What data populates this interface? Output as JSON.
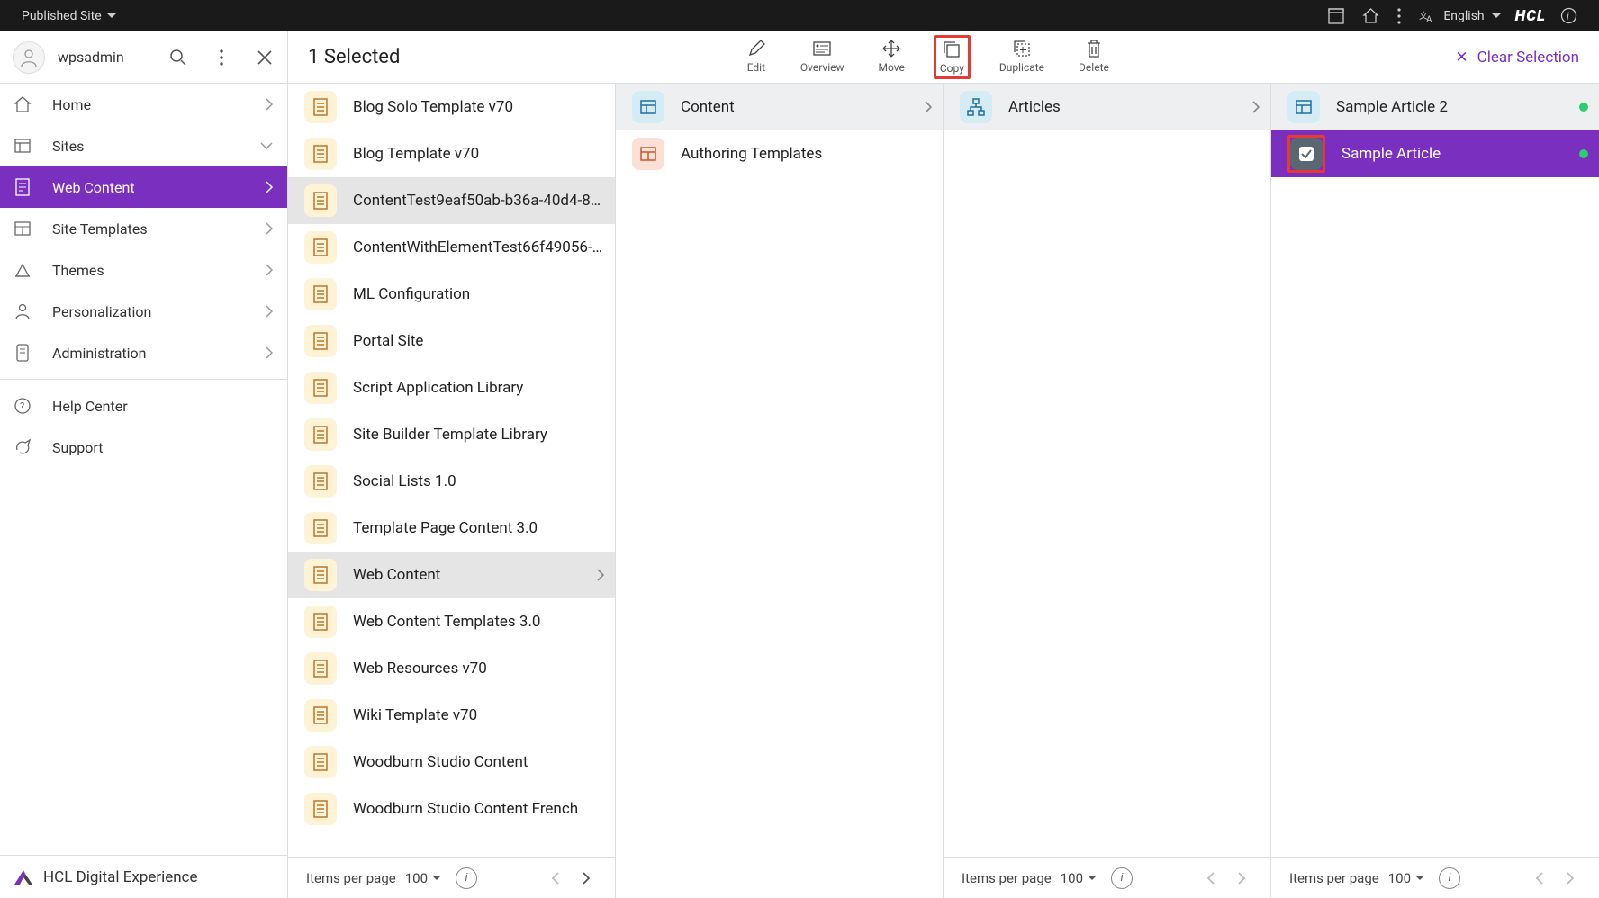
{
  "topbar": {
    "siteLabel": "Published Site",
    "language": "English",
    "logo": "HCL"
  },
  "sidebar": {
    "user": "wpsadmin",
    "items": [
      {
        "icon": "home",
        "label": "Home",
        "chev": "right"
      },
      {
        "icon": "sites",
        "label": "Sites",
        "chev": "down"
      },
      {
        "icon": "doc",
        "label": "Web Content",
        "chev": "right",
        "active": true
      },
      {
        "icon": "sitetpl",
        "label": "Site Templates",
        "chev": "right"
      },
      {
        "icon": "themes",
        "label": "Themes",
        "chev": "right"
      },
      {
        "icon": "person",
        "label": "Personalization",
        "chev": "right"
      },
      {
        "icon": "admin",
        "label": "Administration",
        "chev": "right"
      }
    ],
    "help": {
      "label": "Help Center"
    },
    "support": {
      "label": "Support"
    },
    "footer": "HCL Digital Experience"
  },
  "toolbar": {
    "title": "1 Selected",
    "actions": {
      "edit": "Edit",
      "overview": "Overview",
      "move": "Move",
      "copy": "Copy",
      "duplicate": "Duplicate",
      "delete": "Delete"
    },
    "clear": "Clear Selection"
  },
  "col1": {
    "items": [
      {
        "label": "Blog Solo Template v70"
      },
      {
        "label": "Blog Template v70"
      },
      {
        "label": "ContentTest9eaf50ab-b36a-40d4-8…",
        "hl": true
      },
      {
        "label": "ContentWithElementTest66f49056-…"
      },
      {
        "label": "ML Configuration"
      },
      {
        "label": "Portal Site"
      },
      {
        "label": "Script Application Library"
      },
      {
        "label": "Site Builder Template Library"
      },
      {
        "label": "Social Lists 1.0"
      },
      {
        "label": "Template Page Content 3.0"
      },
      {
        "label": "Web Content",
        "hl": true,
        "chev": true
      },
      {
        "label": "Web Content Templates 3.0"
      },
      {
        "label": "Web Resources v70"
      },
      {
        "label": "Wiki Template v70"
      },
      {
        "label": "Woodburn Studio Content"
      },
      {
        "label": "Woodburn Studio Content French"
      }
    ]
  },
  "col2": {
    "items": [
      {
        "icon": "site",
        "label": "Content",
        "head": true,
        "chev": true
      },
      {
        "icon": "tmpl",
        "label": "Authoring Templates"
      }
    ]
  },
  "col3": {
    "items": [
      {
        "icon": "tree",
        "label": "Articles",
        "head": true,
        "chev": true
      }
    ]
  },
  "col4": {
    "items": [
      {
        "icon": "site",
        "label": "Sample Article 2",
        "head": true,
        "dot": true
      },
      {
        "icon": "chk",
        "label": "Sample Article",
        "sel": true,
        "dot": true
      }
    ]
  },
  "pager": {
    "label": "Items per page",
    "value": "100"
  }
}
